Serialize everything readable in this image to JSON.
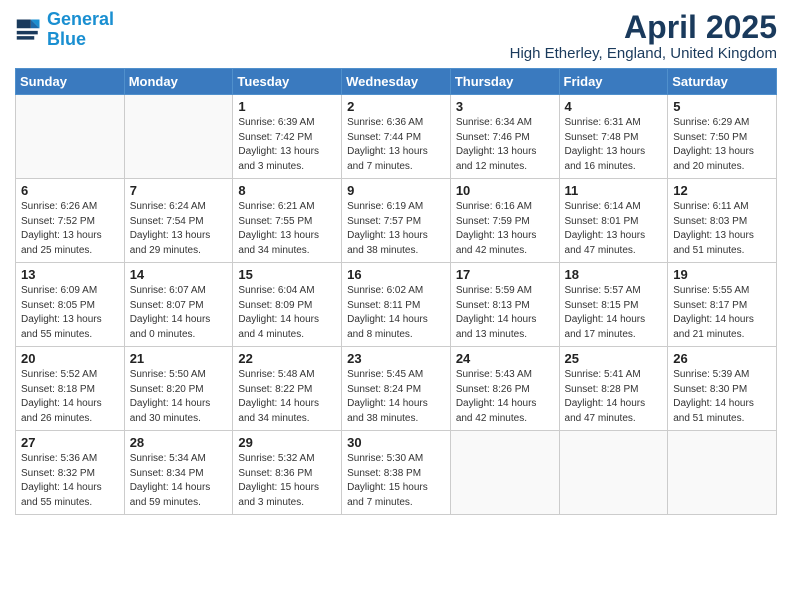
{
  "header": {
    "logo_line1": "General",
    "logo_line2": "Blue",
    "month_title": "April 2025",
    "location": "High Etherley, England, United Kingdom"
  },
  "weekdays": [
    "Sunday",
    "Monday",
    "Tuesday",
    "Wednesday",
    "Thursday",
    "Friday",
    "Saturday"
  ],
  "weeks": [
    [
      {
        "day": "",
        "info": ""
      },
      {
        "day": "",
        "info": ""
      },
      {
        "day": "1",
        "info": "Sunrise: 6:39 AM\nSunset: 7:42 PM\nDaylight: 13 hours and 3 minutes."
      },
      {
        "day": "2",
        "info": "Sunrise: 6:36 AM\nSunset: 7:44 PM\nDaylight: 13 hours and 7 minutes."
      },
      {
        "day": "3",
        "info": "Sunrise: 6:34 AM\nSunset: 7:46 PM\nDaylight: 13 hours and 12 minutes."
      },
      {
        "day": "4",
        "info": "Sunrise: 6:31 AM\nSunset: 7:48 PM\nDaylight: 13 hours and 16 minutes."
      },
      {
        "day": "5",
        "info": "Sunrise: 6:29 AM\nSunset: 7:50 PM\nDaylight: 13 hours and 20 minutes."
      }
    ],
    [
      {
        "day": "6",
        "info": "Sunrise: 6:26 AM\nSunset: 7:52 PM\nDaylight: 13 hours and 25 minutes."
      },
      {
        "day": "7",
        "info": "Sunrise: 6:24 AM\nSunset: 7:54 PM\nDaylight: 13 hours and 29 minutes."
      },
      {
        "day": "8",
        "info": "Sunrise: 6:21 AM\nSunset: 7:55 PM\nDaylight: 13 hours and 34 minutes."
      },
      {
        "day": "9",
        "info": "Sunrise: 6:19 AM\nSunset: 7:57 PM\nDaylight: 13 hours and 38 minutes."
      },
      {
        "day": "10",
        "info": "Sunrise: 6:16 AM\nSunset: 7:59 PM\nDaylight: 13 hours and 42 minutes."
      },
      {
        "day": "11",
        "info": "Sunrise: 6:14 AM\nSunset: 8:01 PM\nDaylight: 13 hours and 47 minutes."
      },
      {
        "day": "12",
        "info": "Sunrise: 6:11 AM\nSunset: 8:03 PM\nDaylight: 13 hours and 51 minutes."
      }
    ],
    [
      {
        "day": "13",
        "info": "Sunrise: 6:09 AM\nSunset: 8:05 PM\nDaylight: 13 hours and 55 minutes."
      },
      {
        "day": "14",
        "info": "Sunrise: 6:07 AM\nSunset: 8:07 PM\nDaylight: 14 hours and 0 minutes."
      },
      {
        "day": "15",
        "info": "Sunrise: 6:04 AM\nSunset: 8:09 PM\nDaylight: 14 hours and 4 minutes."
      },
      {
        "day": "16",
        "info": "Sunrise: 6:02 AM\nSunset: 8:11 PM\nDaylight: 14 hours and 8 minutes."
      },
      {
        "day": "17",
        "info": "Sunrise: 5:59 AM\nSunset: 8:13 PM\nDaylight: 14 hours and 13 minutes."
      },
      {
        "day": "18",
        "info": "Sunrise: 5:57 AM\nSunset: 8:15 PM\nDaylight: 14 hours and 17 minutes."
      },
      {
        "day": "19",
        "info": "Sunrise: 5:55 AM\nSunset: 8:17 PM\nDaylight: 14 hours and 21 minutes."
      }
    ],
    [
      {
        "day": "20",
        "info": "Sunrise: 5:52 AM\nSunset: 8:18 PM\nDaylight: 14 hours and 26 minutes."
      },
      {
        "day": "21",
        "info": "Sunrise: 5:50 AM\nSunset: 8:20 PM\nDaylight: 14 hours and 30 minutes."
      },
      {
        "day": "22",
        "info": "Sunrise: 5:48 AM\nSunset: 8:22 PM\nDaylight: 14 hours and 34 minutes."
      },
      {
        "day": "23",
        "info": "Sunrise: 5:45 AM\nSunset: 8:24 PM\nDaylight: 14 hours and 38 minutes."
      },
      {
        "day": "24",
        "info": "Sunrise: 5:43 AM\nSunset: 8:26 PM\nDaylight: 14 hours and 42 minutes."
      },
      {
        "day": "25",
        "info": "Sunrise: 5:41 AM\nSunset: 8:28 PM\nDaylight: 14 hours and 47 minutes."
      },
      {
        "day": "26",
        "info": "Sunrise: 5:39 AM\nSunset: 8:30 PM\nDaylight: 14 hours and 51 minutes."
      }
    ],
    [
      {
        "day": "27",
        "info": "Sunrise: 5:36 AM\nSunset: 8:32 PM\nDaylight: 14 hours and 55 minutes."
      },
      {
        "day": "28",
        "info": "Sunrise: 5:34 AM\nSunset: 8:34 PM\nDaylight: 14 hours and 59 minutes."
      },
      {
        "day": "29",
        "info": "Sunrise: 5:32 AM\nSunset: 8:36 PM\nDaylight: 15 hours and 3 minutes."
      },
      {
        "day": "30",
        "info": "Sunrise: 5:30 AM\nSunset: 8:38 PM\nDaylight: 15 hours and 7 minutes."
      },
      {
        "day": "",
        "info": ""
      },
      {
        "day": "",
        "info": ""
      },
      {
        "day": "",
        "info": ""
      }
    ]
  ]
}
